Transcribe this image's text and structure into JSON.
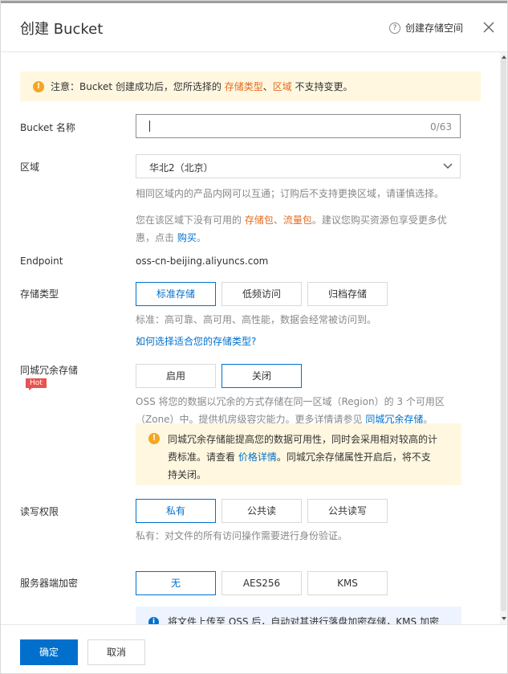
{
  "dialog": {
    "title": "创建 Bucket",
    "help_link": "创建存储空间",
    "help_icon": "question-circle-icon",
    "close_icon": "close-icon"
  },
  "notice": {
    "prefix": "注意：Bucket 创建成功后，您所选择的 ",
    "link1": "存储类型",
    "sep": "、",
    "link2": "区域",
    "suffix": " 不支持变更。"
  },
  "bucket_name": {
    "label": "Bucket 名称",
    "value": "",
    "counter": "0/63"
  },
  "region": {
    "label": "区域",
    "selected": "华北2（北京）",
    "hint": "相同区域内的产品内网可以互通；订购后不支持更换区域，请谨慎选择。",
    "pkg_prefix": "您在该区域下没有可用的 ",
    "pkg_link1": "存储包",
    "pkg_sep": "、",
    "pkg_link2": "流量包",
    "pkg_mid": "。建议您购买资源包享受更多优",
    "pkg_line2": "惠，点击 ",
    "pkg_buy": "购买",
    "pkg_end": "。"
  },
  "endpoint": {
    "label": "Endpoint",
    "value": "oss-cn-beijing.aliyuncs.com"
  },
  "storage_class": {
    "label": "存储类型",
    "options": [
      "标准存储",
      "低频访问",
      "归档存储"
    ],
    "selected": "标准存储",
    "hint": "标准：高可靠、高可用、高性能，数据会经常被访问到。",
    "link": "如何选择适合您的存储类型?"
  },
  "zrs": {
    "label": "同城冗余存储",
    "badge": "Hot",
    "options": [
      "启用",
      "关闭"
    ],
    "selected": "关闭",
    "desc_line1": "OSS 将您的数据以冗余的方式存储在同一区域（Region）的 3 个可用区",
    "desc_line2": "（Zone）中。提供机房级容灾能力。更多详情请参见 ",
    "desc_link": "同城冗余存储",
    "desc_end": "。",
    "warn_line1": "同城冗余存储能提高您的数据可用性，同时会采用相对较高的计",
    "warn_line2_prefix": "费标准。请查看 ",
    "warn_link": "价格详情",
    "warn_line2_suffix": "。同城冗余存储属性开启后，将不支",
    "warn_line3": "持关闭。"
  },
  "acl": {
    "label": "读写权限",
    "options": [
      "私有",
      "公共读",
      "公共读写"
    ],
    "selected": "私有",
    "hint": "私有：对文件的所有访问操作需要进行身份验证。"
  },
  "encryption": {
    "label": "服务器端加密",
    "options": [
      "无",
      "AES256",
      "KMS"
    ],
    "selected": "无",
    "info": "将文件上传至 OSS 后，自动对其进行落盘加密存储，KMS 加密"
  },
  "footer": {
    "confirm": "确定",
    "cancel": "取消"
  },
  "colors": {
    "primary": "#0070cc",
    "link_orange": "#e56b1f",
    "warn_bg": "#fff7e0",
    "hot": "#e8534f"
  }
}
